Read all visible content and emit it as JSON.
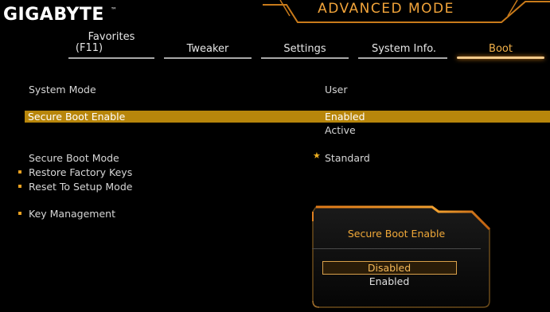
{
  "header": {
    "brand": "GIGABYTE",
    "brand_tm": "™",
    "mode_title": "ADVANCED MODE"
  },
  "tabs": [
    {
      "label_line1": "Favorites",
      "label_line2": "(F11)"
    },
    {
      "label": "Tweaker"
    },
    {
      "label": "Settings"
    },
    {
      "label": "System Info."
    },
    {
      "label": "Boot",
      "active": true
    }
  ],
  "settings": {
    "system_mode": {
      "label": "System Mode",
      "value": "User"
    },
    "secure_boot_enable": {
      "label": "Secure Boot Enable",
      "value": "Enabled",
      "status": "Active"
    },
    "secure_boot_mode": {
      "label": "Secure Boot Mode",
      "value": "Standard"
    },
    "restore_factory_keys": {
      "label": "Restore Factory Keys"
    },
    "reset_to_setup_mode": {
      "label": "Reset To Setup Mode"
    },
    "key_management": {
      "label": "Key Management"
    }
  },
  "dialog": {
    "title": "Secure Boot Enable",
    "options": [
      "Disabled",
      "Enabled"
    ],
    "selected": "Disabled"
  },
  "colors": {
    "accent": "#f2a43a",
    "highlight_bar": "#b8860b",
    "background": "#000000"
  },
  "icons": {
    "bullet": "square-bullet-icon",
    "star": "star-icon"
  }
}
